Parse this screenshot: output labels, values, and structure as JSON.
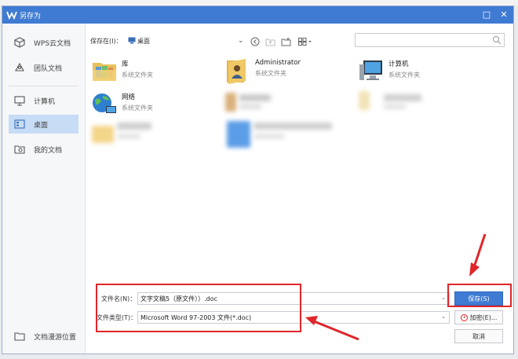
{
  "window": {
    "title": "另存为",
    "minimize_glyph": "□",
    "close_glyph": "✕"
  },
  "sidebar": {
    "items": [
      {
        "label": "WPS云文档",
        "icon": "cube-icon"
      },
      {
        "label": "团队文档",
        "icon": "team-icon"
      },
      {
        "label": "计算机",
        "icon": "monitor-icon"
      },
      {
        "label": "桌面",
        "icon": "desktop-icon",
        "active": true
      },
      {
        "label": "我的文档",
        "icon": "document-folder-icon"
      }
    ],
    "footer_label": "文档漫游位置"
  },
  "location": {
    "label": "保存在(I)：",
    "value": "桌面"
  },
  "files": [
    {
      "name": "库",
      "type": "系统文件夹",
      "icon": "library-folder-icon"
    },
    {
      "name": "Administrator",
      "type": "系统文件夹",
      "icon": "user-folder-icon"
    },
    {
      "name": "计算机",
      "type": "系统文件夹",
      "icon": "computer-icon"
    },
    {
      "name": "网络",
      "type": "系统文件夹",
      "icon": "network-icon"
    }
  ],
  "form": {
    "filename_label": "文件名(N)：",
    "filename_value": "文字文稿5（原文件））.doc",
    "filetype_label": "文件类型(T)：",
    "filetype_value": "Microsoft Word 97-2003 文件(*.doc)",
    "save_label": "保存(S)",
    "encrypt_label": "加密(E)...",
    "cancel_label": "取消"
  },
  "colors": {
    "titlebar": "#3f7bd2",
    "active_sidebar": "#c7dcf5",
    "annotation": "#e0262a"
  }
}
